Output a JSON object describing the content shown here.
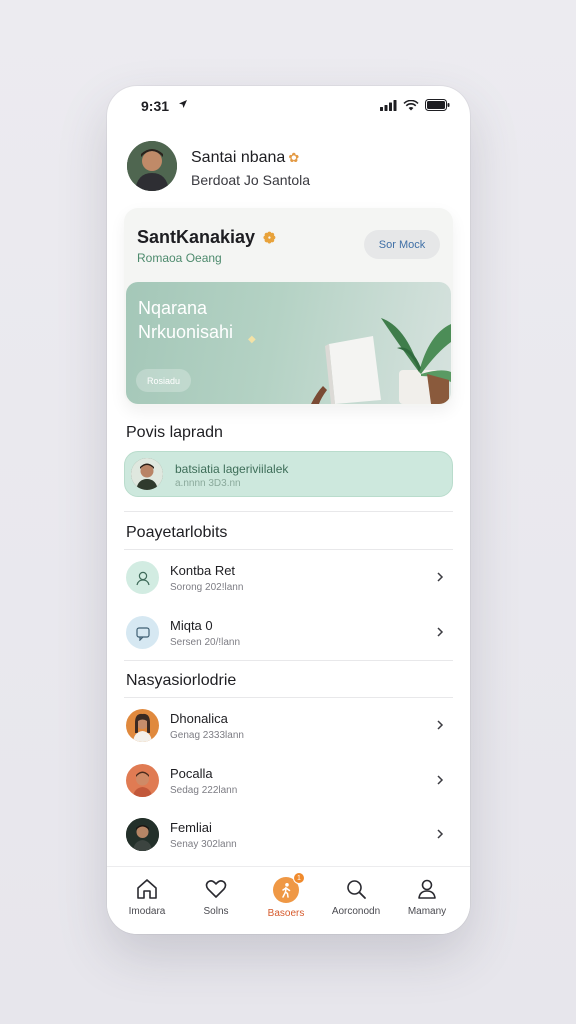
{
  "status_bar": {
    "time": "9:31"
  },
  "profile": {
    "name": "Santai nbana",
    "subtitle": "Berdoat Jo Santola"
  },
  "hero_card": {
    "title": "SantKanakiay",
    "subtitle": "Romaoa Oeang",
    "see_button": "Sor Mock",
    "banner_line1": "Nqarana",
    "banner_line2": "Nrkuonisahi",
    "banner_button": "Rosiadu"
  },
  "section_popular": {
    "title": "Povis lapradn",
    "featured_title": "batsiatia lageriviilalek",
    "featured_sub": "a.nnnn 3D3.nn"
  },
  "section_projects": {
    "title": "Poayetarlobits",
    "items": [
      {
        "title": "Kontba Ret",
        "subtitle": "Sorong 202!lann",
        "icon": "user-icon"
      },
      {
        "title": "Miqta 0",
        "subtitle": "Sersen 20/!lann",
        "icon": "message-icon"
      }
    ]
  },
  "section_messages": {
    "title": "Nasyasiorlodrie",
    "items": [
      {
        "title": "Dhonalica",
        "subtitle": "Genag 2333lann",
        "icon": "avatar-woman"
      },
      {
        "title": "Pocalla",
        "subtitle": "Sedag 222lann",
        "icon": "avatar-man"
      },
      {
        "title": "Femliai",
        "subtitle": "Senay 302lann",
        "icon": "avatar-dark"
      }
    ]
  },
  "tab_bar": {
    "tabs": [
      {
        "label": "Imodara",
        "icon": "home-icon"
      },
      {
        "label": "Solns",
        "icon": "heart-icon"
      },
      {
        "label": "Basoers",
        "icon": "person-run-icon",
        "active": true,
        "badge": "1"
      },
      {
        "label": "Aorconodn",
        "icon": "search-icon"
      },
      {
        "label": "Mamany",
        "icon": "profile-icon"
      }
    ]
  },
  "colors": {
    "accent_green": "#cde8dd",
    "accent_orange": "#ef9845",
    "link_blue": "#3f6fa6"
  }
}
